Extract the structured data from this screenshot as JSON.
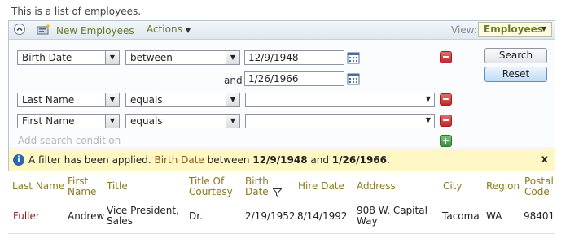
{
  "description": "This is a list of employees.",
  "actionbar": {
    "new_label": "New Employees",
    "actions_label": "Actions",
    "view_label": "View:",
    "view_value": "Employees"
  },
  "conditions": [
    {
      "field": "Birth Date",
      "operator": "between",
      "value1": "12/9/1948",
      "and_label": "and",
      "value2": "1/26/1966"
    },
    {
      "field": "Last Name",
      "operator": "equals",
      "value1": ""
    },
    {
      "field": "First Name",
      "operator": "equals",
      "value1": ""
    }
  ],
  "add_condition_label": "Add search condition",
  "buttons": {
    "search": "Search",
    "reset": "Reset"
  },
  "filter": {
    "prefix": "A filter has been applied.",
    "field": "Birth Date",
    "between": "between",
    "from": "12/9/1948",
    "and": "and",
    "to": "1/26/1966",
    "suffix": ".",
    "close": "x"
  },
  "grid": {
    "columns": [
      "Last Name",
      "First Name",
      "Title",
      "Title Of Courtesy",
      "Birth Date",
      "Hire Date",
      "Address",
      "City",
      "Region",
      "Postal Code"
    ],
    "rows": [
      [
        "Fuller",
        "Andrew",
        "Vice President, Sales",
        "Dr.",
        "2/19/1952",
        "8/14/1992",
        "908 W. Capital Way",
        "Tacoma",
        "WA",
        "98401"
      ]
    ]
  },
  "colors": {
    "accent": "#6a7a2a",
    "link": "#8b1d1d",
    "filter_bg": "#fff7c4",
    "header_text": "#8a7a20"
  }
}
